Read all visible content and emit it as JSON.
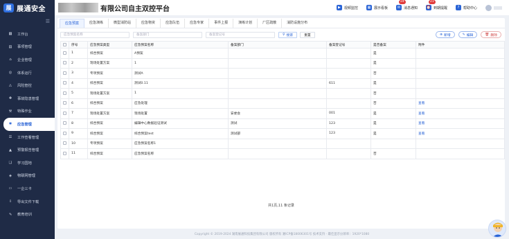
{
  "app": {
    "logo_text": "展通安全",
    "logo_mark": "展",
    "platform_title": "有限公司自主双控平台"
  },
  "header": {
    "actions": [
      {
        "label": "视频监控",
        "icon": "video-icon",
        "badge": ""
      },
      {
        "label": "展示看板",
        "icon": "dashboard-icon",
        "badge": ""
      },
      {
        "label": "消息通知",
        "icon": "bell-icon",
        "badge": "24"
      },
      {
        "label": "到期提醒",
        "icon": "alarm-icon",
        "badge": "21"
      },
      {
        "label": "帮助中心",
        "icon": "help-icon",
        "badge": ""
      }
    ]
  },
  "sidebar": {
    "items": [
      {
        "label": "工作台",
        "icon": "workbench-icon",
        "active": false
      },
      {
        "label": "事项管理",
        "icon": "task-icon",
        "active": false
      },
      {
        "label": "企业管理",
        "icon": "company-icon",
        "active": false
      },
      {
        "label": "体系运行",
        "icon": "system-icon",
        "active": false
      },
      {
        "label": "风险管控",
        "icon": "risk-icon",
        "active": false
      },
      {
        "label": "事故隐患管理",
        "icon": "hazard-icon",
        "active": false
      },
      {
        "label": "特殊作业",
        "icon": "special-work-icon",
        "active": false
      },
      {
        "label": "应急管理",
        "icon": "emergency-icon",
        "active": true
      },
      {
        "label": "工作查看管理",
        "icon": "review-icon",
        "active": false
      },
      {
        "label": "预警报告管理",
        "icon": "warning-icon",
        "active": false
      },
      {
        "label": "学习园地",
        "icon": "study-icon",
        "active": false
      },
      {
        "label": "物联网管理",
        "icon": "iot-icon",
        "active": false
      },
      {
        "label": "一企三卡",
        "icon": "card-icon",
        "active": false
      },
      {
        "label": "导出文件下载",
        "icon": "download-icon",
        "active": false
      },
      {
        "label": "教育培训",
        "icon": "training-icon",
        "active": false
      }
    ]
  },
  "tabs": [
    "应急预案",
    "应急演练",
    "微型消防站",
    "应急物资",
    "应急队伍",
    "应急专家",
    "事件上报",
    "演练计划",
    "厂区疏散",
    "消防设施分布"
  ],
  "toolbar": {
    "search_name_placeholder": "应急预案名称",
    "search_dept_placeholder": "备案部门",
    "search_reg_placeholder": "备案登记号",
    "search_label": "搜索",
    "reset_label": "重置",
    "add_label": "新增",
    "edit_label": "编辑",
    "delete_label": "删除"
  },
  "table": {
    "columns": [
      "序号",
      "应急预案类型",
      "应急预案名称",
      "备案部门",
      "备案登记号",
      "是否备案",
      "附件"
    ],
    "rows": [
      [
        "1",
        "综合预案",
        "A预案",
        "",
        "",
        "是",
        ""
      ],
      [
        "2",
        "现场处置方案",
        "1",
        "",
        "",
        "是",
        ""
      ],
      [
        "3",
        "专项预案",
        "测试A",
        "",
        "",
        "否",
        ""
      ],
      [
        "4",
        "综合预案",
        "测试0.11",
        "",
        "611",
        "是",
        ""
      ],
      [
        "5",
        "现场处置方案",
        "1",
        "",
        "",
        "否",
        ""
      ],
      [
        "6",
        "综合预案",
        "应急处理",
        "",
        "",
        "否",
        "查看"
      ],
      [
        "7",
        "现场处置方案",
        "现场处置",
        "安委会",
        "001",
        "是",
        "查看"
      ],
      [
        "8",
        "综合预案",
        "编辑中心数据验证测试",
        "测试",
        "123",
        "是",
        "查看"
      ],
      [
        "9",
        "综合预案",
        "综合预案test",
        "测试部",
        "123",
        "是",
        "查看"
      ],
      [
        "10",
        "专项预案",
        "应急预案名称1",
        "",
        "",
        "",
        ""
      ],
      [
        "11",
        "综合预案",
        "应急预案名称",
        "",
        "",
        "否",
        ""
      ]
    ]
  },
  "pager": {
    "summary": "共1页,11 条记录"
  },
  "footer": {
    "text": "Copyright © 2019-2024 湖南展通科技集团有限公司 版权所有 湘ICP备18006301号 技术支持 · 最佳显示分辨率：1920*1080"
  }
}
